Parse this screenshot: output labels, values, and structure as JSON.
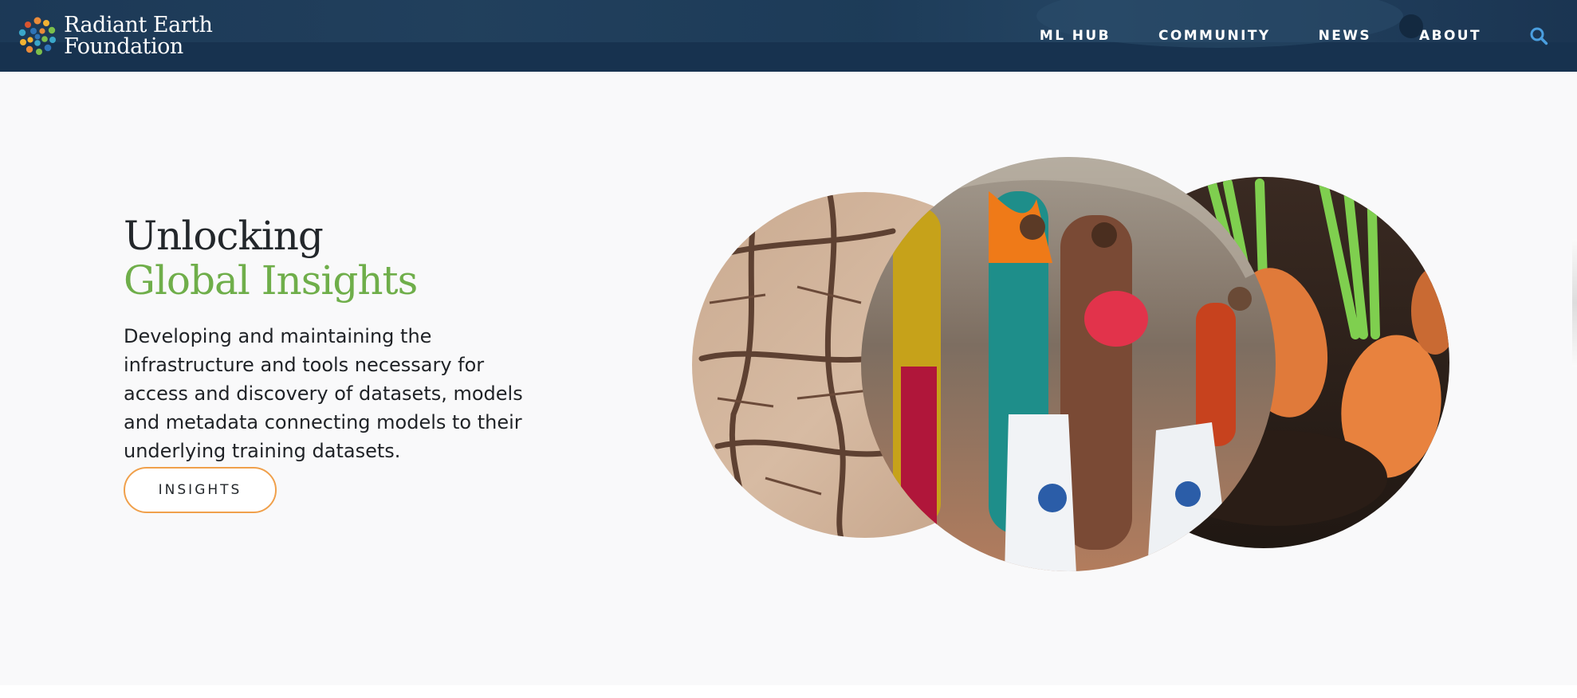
{
  "header": {
    "logo_line1": "Radiant Earth",
    "logo_line2": "Foundation",
    "nav": [
      {
        "label": "ML HUB"
      },
      {
        "label": "COMMUNITY"
      },
      {
        "label": "NEWS"
      },
      {
        "label": "ABOUT"
      }
    ],
    "search_icon": "search-icon"
  },
  "hero": {
    "title_line1": "Unlocking",
    "title_line2": "Global Insights",
    "description": "Developing and maintaining the infrastructure and tools necessary for access and discovery of datasets, models and metadata connecting models to their underlying training datasets.",
    "cta_label": "INSIGHTS"
  },
  "colors": {
    "header_bg": "#17324f",
    "accent_green": "#6fae4a",
    "button_border": "#f0a04b",
    "search_icon": "#4a9fe0"
  }
}
